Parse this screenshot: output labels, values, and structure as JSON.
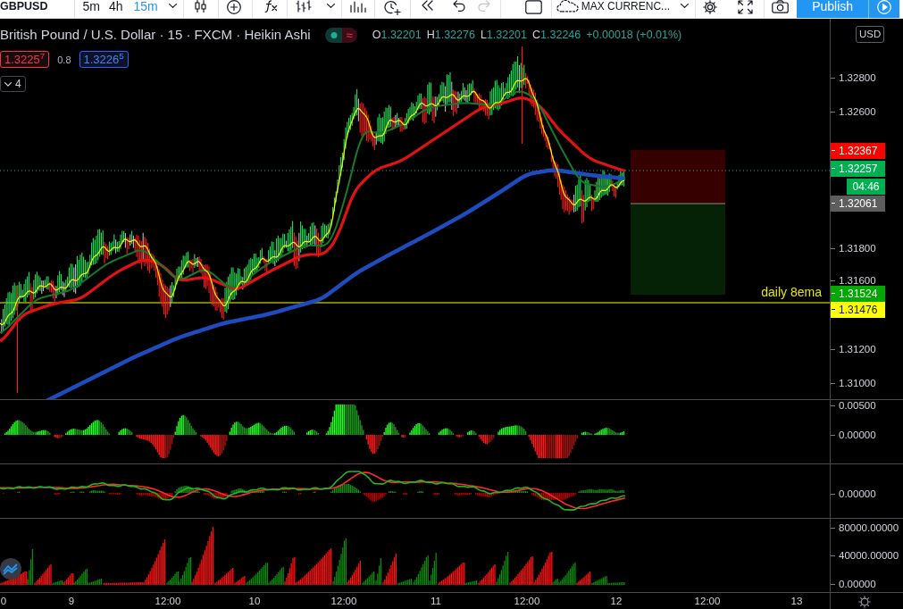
{
  "toolbar": {
    "symbol": "GBPUSD",
    "intervals": [
      {
        "label": "5m",
        "selected": false
      },
      {
        "label": "4h",
        "selected": false
      },
      {
        "label": "15m",
        "selected": true
      }
    ],
    "history": [
      {
        "kind": "undo",
        "disabled": false
      },
      {
        "kind": "redo",
        "disabled": true
      }
    ],
    "layout": "MAX CURRENC...",
    "publish": "Publish"
  },
  "legend": {
    "title": "British Pound / U.S. Dollar · 15 · FXCM · Heikin Ashi",
    "status_symbol": "≈",
    "ohlc": [
      {
        "letter": "O",
        "value": "1.32201"
      },
      {
        "letter": "H",
        "value": "1.32276"
      },
      {
        "letter": "L",
        "value": "1.32201"
      },
      {
        "letter": "C",
        "value": "1.32246"
      }
    ],
    "change": "+0.00018 (+0.01%)",
    "sell": "1.3225$^{7}$",
    "spread": "0.8",
    "buy": "1.3226$^{5}$",
    "indicator_count": "4"
  },
  "chart": {
    "drawing_label": "daily 8ema"
  },
  "price_axis": {
    "currency": "USD",
    "ticks": [
      "1.32800",
      "1.32600",
      "1.31800",
      "1.31600",
      "1.31200",
      "1.31000"
    ],
    "markers": [
      {
        "kind": "price",
        "text": "1.32367",
        "color": "#ff0000"
      },
      {
        "kind": "price",
        "text": "1.32257",
        "color": "#00b050"
      },
      {
        "kind": "countdown",
        "text": "04:46",
        "color": "#00b050"
      },
      {
        "kind": "price",
        "text": "1.32061",
        "color": "#5d5d5d"
      },
      {
        "kind": "price",
        "text": "1.31524",
        "color": "#00a800"
      },
      {
        "kind": "price",
        "text": "1.31476",
        "color": "#ffff00"
      }
    ]
  },
  "indicator_panes": [
    {
      "axis_ticks": [
        "0.00500",
        "0.00000"
      ]
    },
    {
      "axis_ticks": [
        "0.00000"
      ]
    },
    {
      "axis_ticks": [
        "80000.00000",
        "40000.00000",
        "0.00000"
      ]
    }
  ],
  "time_axis": {
    "labels": [
      "0",
      "9",
      "12:00",
      "10",
      "12:00",
      "11",
      "12:00",
      "12",
      "12:00",
      "13"
    ]
  }
}
